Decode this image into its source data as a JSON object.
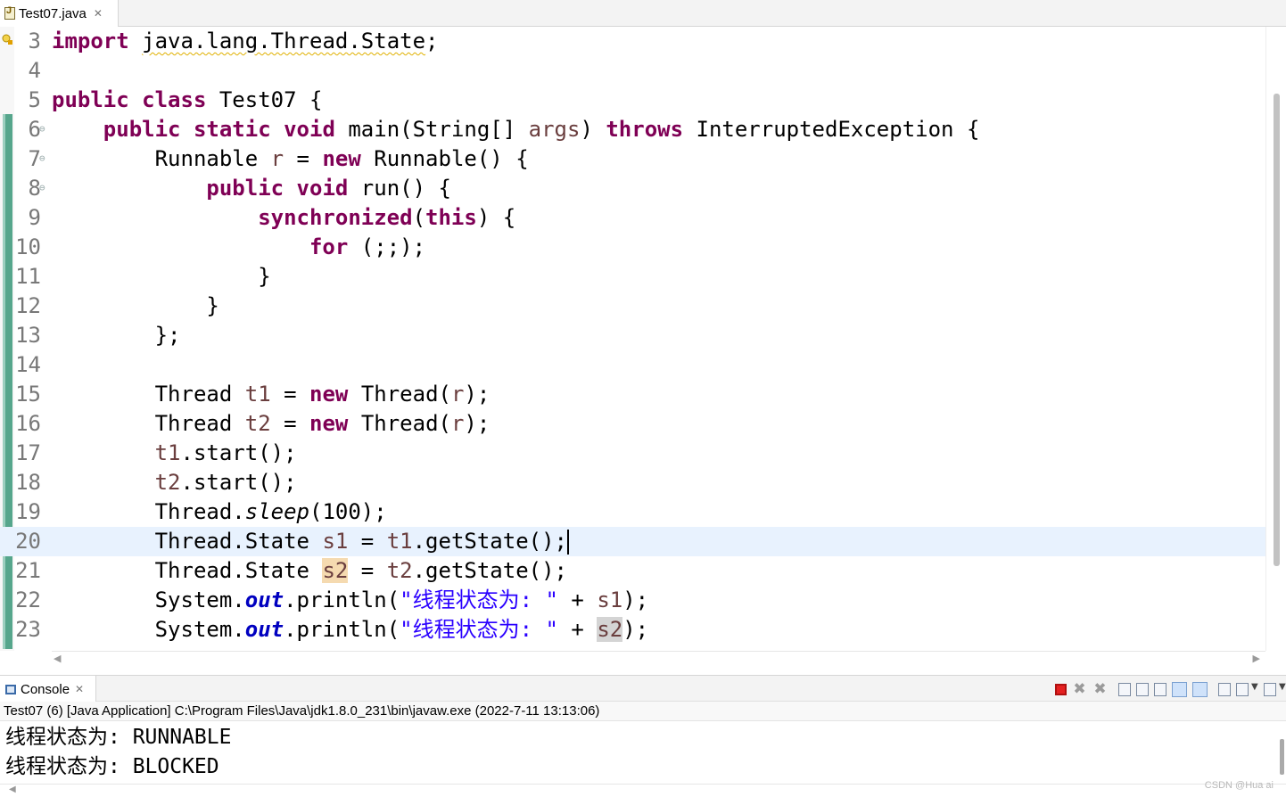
{
  "editor": {
    "tab_label": "Test07.java",
    "lines": [
      {
        "num": "3",
        "html_key": "l3"
      },
      {
        "num": "4"
      },
      {
        "num": "5"
      },
      {
        "num": "6"
      },
      {
        "num": "7"
      },
      {
        "num": "8"
      },
      {
        "num": "9"
      },
      {
        "num": "10"
      },
      {
        "num": "11"
      },
      {
        "num": "12"
      },
      {
        "num": "13"
      },
      {
        "num": "14"
      },
      {
        "num": "15"
      },
      {
        "num": "16"
      },
      {
        "num": "17"
      },
      {
        "num": "18"
      },
      {
        "num": "19"
      },
      {
        "num": "20"
      },
      {
        "num": "21"
      },
      {
        "num": "22"
      },
      {
        "num": "23"
      }
    ],
    "code": {
      "import_kw": "import",
      "import_path": "java.lang.Thread.State",
      "public": "public",
      "class": "class",
      "static": "static",
      "void": "void",
      "new": "new",
      "throws": "throws",
      "synchronized": "synchronized",
      "this": "this",
      "for": "for",
      "class_name": "Test07",
      "main": "main",
      "string_arr": "String[]",
      "args": "args",
      "exception": "InterruptedException",
      "runnable": "Runnable",
      "r": "r",
      "run": "run",
      "for_body": " (;;);",
      "thread": "Thread",
      "t1": "t1",
      "t2": "t2",
      "start": "start",
      "sleep": "sleep",
      "sleep_arg": "100",
      "thread_state": "Thread.State",
      "s1": "s1",
      "s2": "s2",
      "getstate": "getState",
      "system": "System",
      "out": "out",
      "println": "println",
      "str_literal": "\"线程状态为: \""
    }
  },
  "console": {
    "tab_label": "Console",
    "launch_info": "Test07 (6) [Java Application] C:\\Program Files\\Java\\jdk1.8.0_231\\bin\\javaw.exe  (2022-7-11 13:13:06)",
    "output": [
      "线程状态为: RUNNABLE",
      "线程状态为: BLOCKED"
    ]
  },
  "watermark": "CSDN @Hua ai",
  "icons": [
    "java-file-icon",
    "close-tab-icon",
    "warning-lightbulb-icon",
    "fold-collapse-icon",
    "console-icon",
    "terminate-icon",
    "remove-launch-icon",
    "remove-all-icon",
    "scroll-lock-icon",
    "word-wrap-icon",
    "show-on-stdout-icon",
    "show-on-stderr-icon",
    "pin-console-icon",
    "display-console-icon",
    "open-console-icon",
    "dropdown-arrow-icon"
  ]
}
